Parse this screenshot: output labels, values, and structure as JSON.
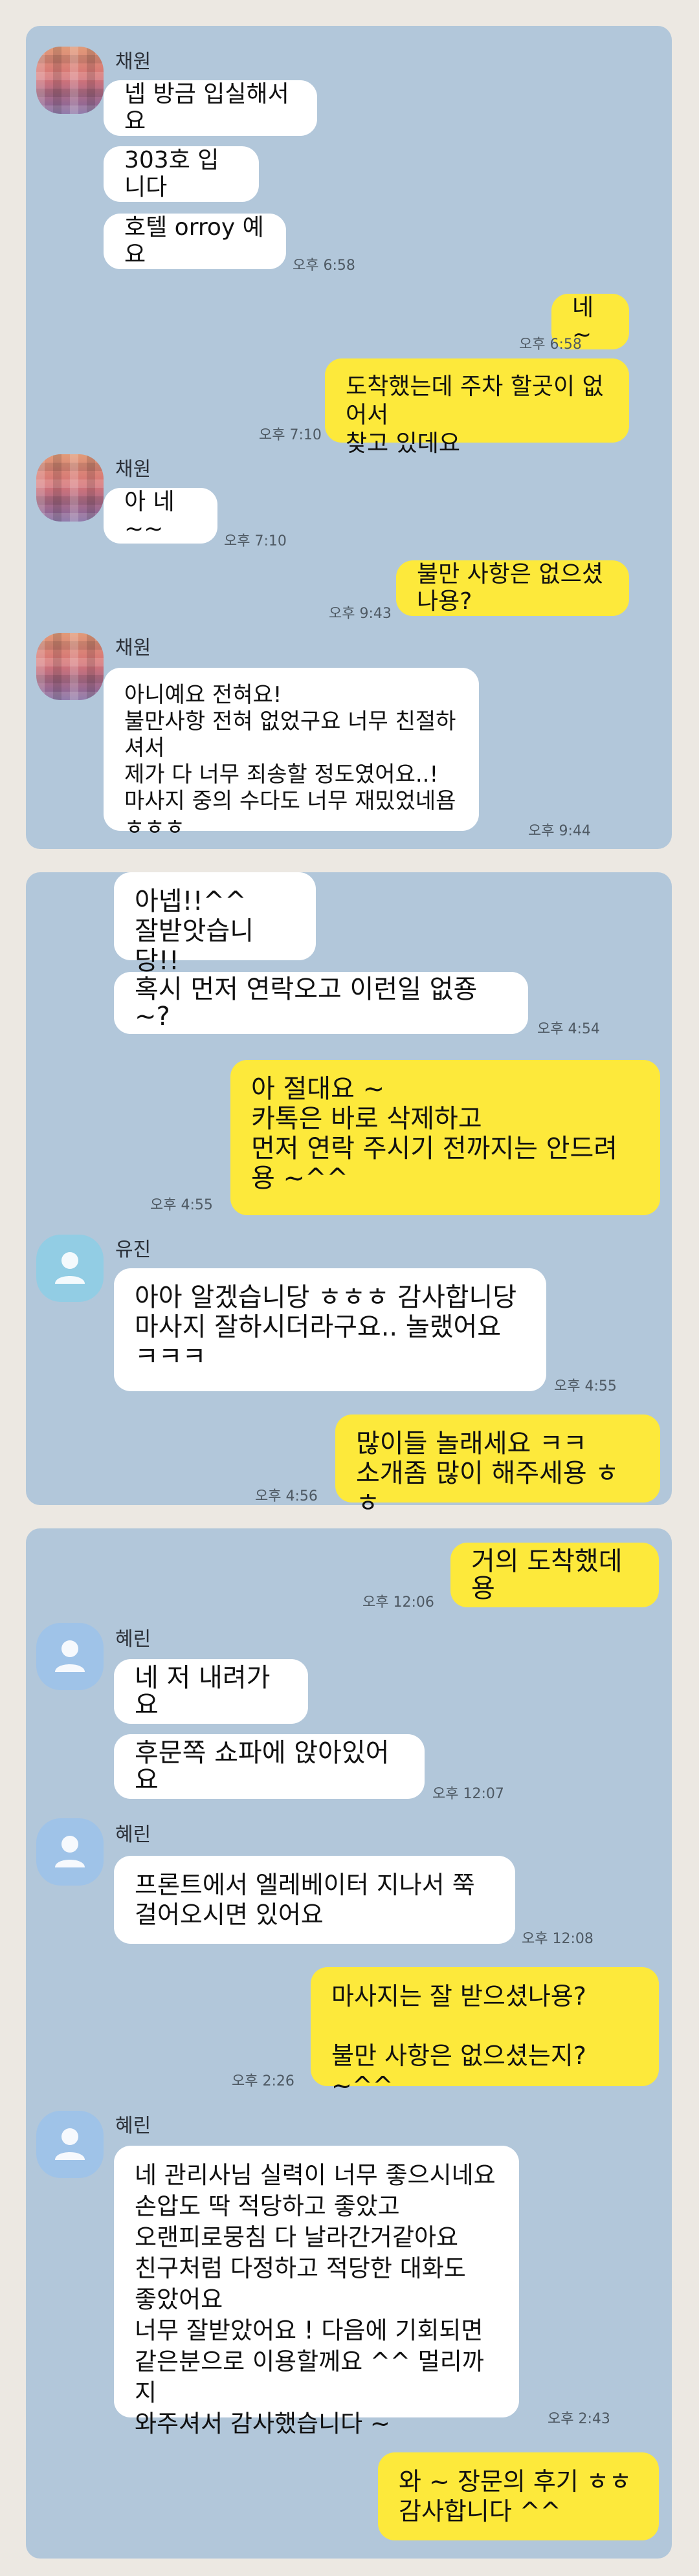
{
  "panel1": {
    "sender_name": "채원",
    "messages": [
      {
        "text": "넵 방금 입실해서요"
      },
      {
        "text": "303호 입니다"
      },
      {
        "text": "호텔 orroy 예요",
        "time": "오후 6:58"
      },
      {
        "text": "네 ~",
        "time": "오후 6:58"
      },
      {
        "text": "도착했는데  주차 할곳이 없어서\n찾고 있데요",
        "time": "오후 7:10"
      },
      {
        "text": "아 네~~",
        "time": "오후 7:10"
      },
      {
        "text": "불만 사항은 없으셨나용?",
        "time": "오후 9:43"
      },
      {
        "text": "아니예요 전혀요!\n불만사항 전혀 없었구요 너무 친절하셔서\n제가 다 너무 죄송할 정도였어요..!\n마사지 중의 수다도 너무 재밌었네욤\nㅎㅎㅎ",
        "time": "오후 9:44"
      }
    ]
  },
  "panel2": {
    "sender_name": "유진",
    "messages": [
      {
        "text": "아넵!!^^\n잘받앗습니당!!"
      },
      {
        "text": "혹시 먼저 연락오고 이런일 없죵~?",
        "time": "오후 4:54"
      },
      {
        "text": "아 절대요 ~\n카톡은 바로 삭제하고\n먼저 연락 주시기 전까지는 안드려\n용 ~^^",
        "time": "오후 4:55"
      },
      {
        "text": "아아 알겠습니당 ㅎㅎㅎ 감사합니당\n마사지 잘하시더라구요.. 놀랬어요\nㅋㅋㅋ",
        "time": "오후 4:55"
      },
      {
        "text": "많이들 놀래세요 ㅋㅋ\n소개좀 많이 해주세용 ㅎㅎ",
        "time": "오후 4:56"
      }
    ]
  },
  "panel3": {
    "sender_name": "혜린",
    "messages": [
      {
        "text": "거의 도착했데용",
        "time": "오후 12:06"
      },
      {
        "text": "네 저 내려가요"
      },
      {
        "text": "후문쪽 쇼파에 앉아있어요",
        "time": "오후 12:07"
      },
      {
        "text": "프론트에서 엘레베이터 지나서 쭉\n걸어오시면 있어요",
        "time": "오후 12:08"
      },
      {
        "text": "마사지는 잘 받으셨나용?\n\n불만 사항은 없으셨는지? ~^^",
        "time": "오후 2:26"
      },
      {
        "text": "네 관리사님 실력이 너무 좋으시네요\n손압도 딱 적당하고 좋았고\n오랜피로뭉침 다 날라간거같아요\n친구처럼 다정하고 적당한 대화도\n좋았어요\n너무 잘받았어요 ! 다음에 기회되면\n같은분으로 이용할께요 ^^ 멀리까지\n와주셔서 감사했습니다 ~",
        "time": "오후 2:43"
      },
      {
        "text": "와 ~ 장문의 후기 ㅎㅎ\n감사합니다 ^^"
      }
    ]
  },
  "icons": {
    "avatar_photo": "avatar-photo-blurred",
    "avatar_default": "user-silhouette-icon"
  },
  "colors": {
    "background": "#ece8e2",
    "chat_bg": "#b2c7da",
    "my_bubble": "#fde93b",
    "their_bubble": "#ffffff"
  }
}
